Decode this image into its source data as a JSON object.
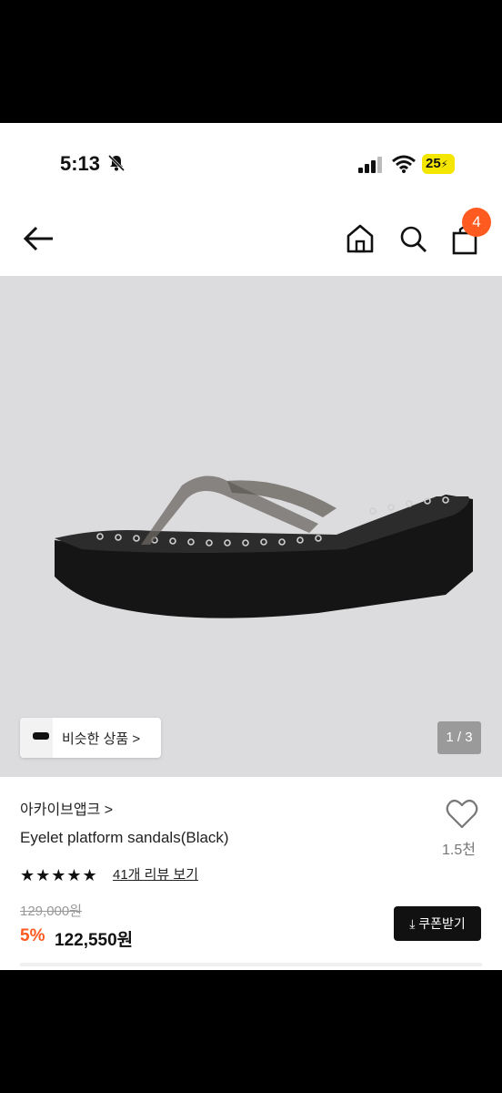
{
  "status_bar": {
    "time": "5:13",
    "battery": "25"
  },
  "nav": {
    "cart_count": "4"
  },
  "hero": {
    "similar_label": "비슷한 상품 >",
    "pager": "1 / 3"
  },
  "product": {
    "brand": "아카이브앱크 >",
    "name": "Eyelet platform sandals(Black)",
    "like_count": "1.5천",
    "rating_stars": "★★★★★",
    "reviews_link": "41개 리뷰 보기",
    "original_price": "129,000원",
    "discount": "5%",
    "price": "122,550원",
    "coupon_button": "쿠폰받기"
  },
  "colors": {
    "accent": "#ff5a1f",
    "dark": "#111111",
    "battery": "#f5e600"
  },
  "icons": [
    "bell-slash-icon",
    "signal-icon",
    "wifi-icon",
    "battery-icon",
    "back-arrow-icon",
    "home-icon",
    "search-icon",
    "bag-icon",
    "heart-icon",
    "download-icon"
  ]
}
